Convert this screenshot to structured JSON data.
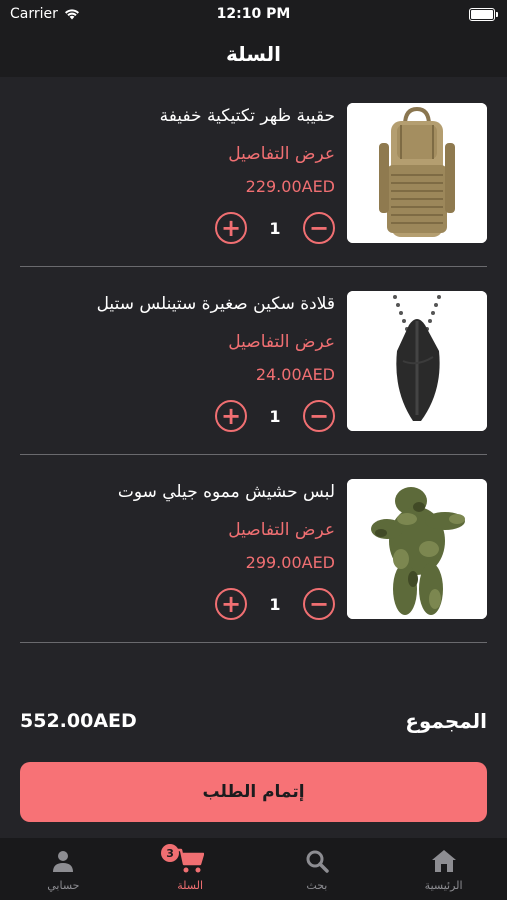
{
  "status_bar": {
    "carrier": "Carrier",
    "time": "12:10 PM"
  },
  "header": {
    "title": "السلة"
  },
  "cart": {
    "items": [
      {
        "name": "حقيبة ظهر تكتيكية خفيفة",
        "details_link": "عرض التفاصيل",
        "price": "229.00AED",
        "quantity": "1",
        "image_icon": "backpack-image"
      },
      {
        "name": "قلادة سكين صغيرة ستينلس ستيل",
        "details_link": "عرض التفاصيل",
        "price": "24.00AED",
        "quantity": "1",
        "image_icon": "knife-necklace-image"
      },
      {
        "name": "لبس حشيش مموه جيلي سوت",
        "details_link": "عرض التفاصيل",
        "price": "299.00AED",
        "quantity": "1",
        "image_icon": "ghillie-suit-image"
      }
    ],
    "plus_symbol": "+",
    "minus_symbol": "−"
  },
  "summary": {
    "total_label": "المجموع",
    "total_value": "552.00AED"
  },
  "checkout": {
    "label": "إتمام الطلب"
  },
  "tab_bar": {
    "tabs": [
      {
        "label": "حسابي",
        "icon": "person-icon"
      },
      {
        "label": "السلة",
        "icon": "cart-icon",
        "badge": "3",
        "active": true
      },
      {
        "label": "بحث",
        "icon": "search-icon"
      },
      {
        "label": "الرئيسية",
        "icon": "home-icon"
      }
    ]
  },
  "colors": {
    "accent": "#f06f72",
    "background": "#242428",
    "bar": "#1c1c1e",
    "button": "#f77276"
  }
}
